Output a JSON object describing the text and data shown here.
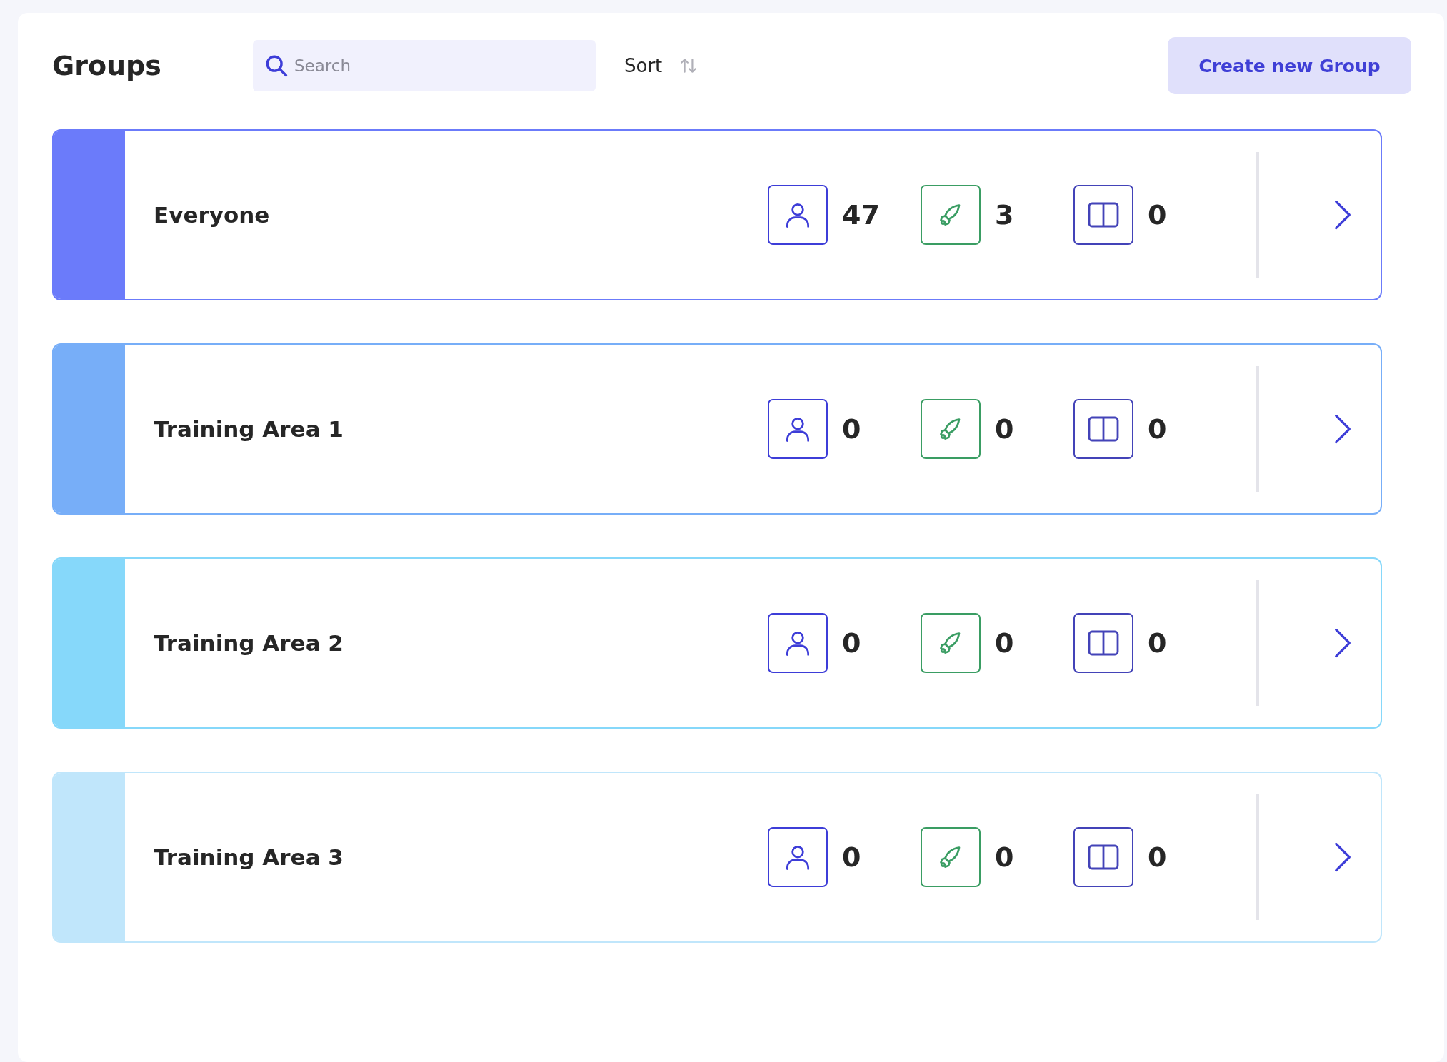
{
  "header": {
    "title": "Groups",
    "search": {
      "placeholder": "Search"
    },
    "sort_label": "Sort",
    "create_button": "Create new Group"
  },
  "groups": [
    {
      "name": "Everyone",
      "color": "#6b7bfa",
      "members": "47",
      "rockets": "3",
      "books": "0"
    },
    {
      "name": "Training Area 1",
      "color": "#77aef8",
      "members": "0",
      "rockets": "0",
      "books": "0"
    },
    {
      "name": "Training Area 2",
      "color": "#86d8fa",
      "members": "0",
      "rockets": "0",
      "books": "0"
    },
    {
      "name": "Training Area 3",
      "color": "#c0e6fb",
      "members": "0",
      "rockets": "0",
      "books": "0"
    }
  ]
}
